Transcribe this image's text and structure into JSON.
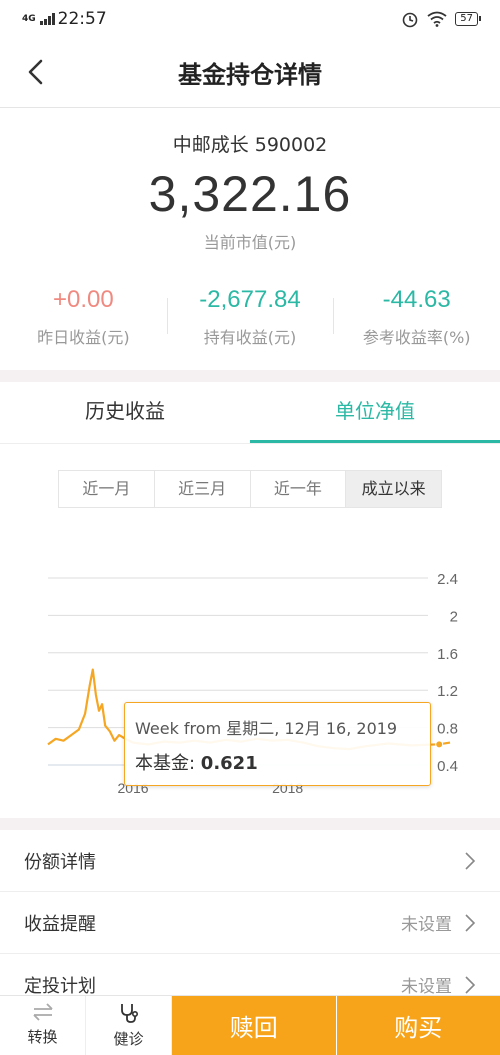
{
  "status_bar": {
    "network": "4G",
    "time": "22:57",
    "battery": "57"
  },
  "header": {
    "title": "基金持仓详情"
  },
  "summary": {
    "fund_name": "中邮成长 590002",
    "market_value": "3,322.16",
    "market_value_label": "当前市值(元)",
    "stats": [
      {
        "value": "+0.00",
        "label": "昨日收益(元)"
      },
      {
        "value": "-2,677.84",
        "label": "持有收益(元)"
      },
      {
        "value": "-44.63",
        "label": "参考收益率(%)"
      }
    ]
  },
  "tabs": [
    {
      "label": "历史收益"
    },
    {
      "label": "单位净值"
    }
  ],
  "ranges": [
    {
      "label": "近一月"
    },
    {
      "label": "近三月"
    },
    {
      "label": "近一年"
    },
    {
      "label": "成立以来"
    }
  ],
  "tooltip": {
    "line1": "Week from 星期二, 12月 16, 2019",
    "series_label": "本基金: ",
    "value": "0.621"
  },
  "chart_data": {
    "type": "line",
    "y_ticks": [
      "2.4",
      "2",
      "1.6",
      "1.2",
      "0.8",
      "0.4"
    ],
    "x_ticks": [
      "2016",
      "2018"
    ],
    "ylim": [
      0.4,
      2.4
    ],
    "grid": true,
    "series": [
      {
        "color": "#f5a623",
        "points": [
          [
            2014.9,
            0.62
          ],
          [
            2015.0,
            0.68
          ],
          [
            2015.1,
            0.66
          ],
          [
            2015.2,
            0.72
          ],
          [
            2015.3,
            0.78
          ],
          [
            2015.38,
            0.95
          ],
          [
            2015.44,
            1.25
          ],
          [
            2015.48,
            1.42
          ],
          [
            2015.52,
            1.15
          ],
          [
            2015.56,
            0.98
          ],
          [
            2015.6,
            1.05
          ],
          [
            2015.64,
            0.82
          ],
          [
            2015.7,
            0.76
          ],
          [
            2015.76,
            0.66
          ],
          [
            2015.82,
            0.72
          ],
          [
            2015.9,
            0.68
          ],
          [
            2016.0,
            0.64
          ],
          [
            2016.2,
            0.62
          ],
          [
            2016.4,
            0.65
          ],
          [
            2016.6,
            0.64
          ],
          [
            2016.8,
            0.66
          ],
          [
            2017.0,
            0.64
          ],
          [
            2017.2,
            0.67
          ],
          [
            2017.4,
            0.65
          ],
          [
            2017.6,
            0.68
          ],
          [
            2017.8,
            0.66
          ],
          [
            2018.0,
            0.67
          ],
          [
            2018.2,
            0.64
          ],
          [
            2018.4,
            0.6
          ],
          [
            2018.6,
            0.58
          ],
          [
            2018.8,
            0.57
          ],
          [
            2019.0,
            0.6
          ],
          [
            2019.3,
            0.63
          ],
          [
            2019.6,
            0.61
          ],
          [
            2019.96,
            0.621
          ],
          [
            2020.1,
            0.64
          ]
        ]
      }
    ]
  },
  "menu": [
    {
      "label": "份额详情",
      "value": ""
    },
    {
      "label": "收益提醒",
      "value": "未设置"
    },
    {
      "label": "定投计划",
      "value": "未设置"
    }
  ],
  "bottom_bar": {
    "transfer": "转换",
    "diagnose": "健诊",
    "redeem": "赎回",
    "buy": "购买"
  }
}
